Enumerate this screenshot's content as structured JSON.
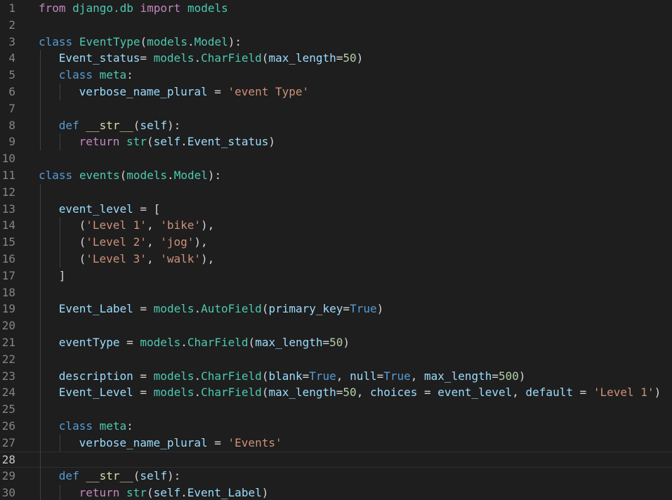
{
  "editor": {
    "lines": [
      {
        "n": "1",
        "indent": 0,
        "tokens": [
          [
            "kw2",
            "from"
          ],
          [
            "txt",
            " "
          ],
          [
            "cls",
            "django.db"
          ],
          [
            "txt",
            " "
          ],
          [
            "kw2",
            "import"
          ],
          [
            "txt",
            " "
          ],
          [
            "cls",
            "models"
          ]
        ]
      },
      {
        "n": "2",
        "indent": 0,
        "tokens": []
      },
      {
        "n": "3",
        "indent": 0,
        "tokens": [
          [
            "kw",
            "class"
          ],
          [
            "txt",
            " "
          ],
          [
            "cls",
            "EventType"
          ],
          [
            "txt",
            "("
          ],
          [
            "cls",
            "models"
          ],
          [
            "txt",
            "."
          ],
          [
            "cls",
            "Model"
          ],
          [
            "txt",
            "):"
          ]
        ]
      },
      {
        "n": "4",
        "indent": 1,
        "tokens": [
          [
            "var",
            "Event_status"
          ],
          [
            "txt",
            "= "
          ],
          [
            "cls",
            "models"
          ],
          [
            "txt",
            "."
          ],
          [
            "cls",
            "CharField"
          ],
          [
            "txt",
            "("
          ],
          [
            "var",
            "max_length"
          ],
          [
            "txt",
            "="
          ],
          [
            "num",
            "50"
          ],
          [
            "txt",
            ")"
          ]
        ]
      },
      {
        "n": "5",
        "indent": 1,
        "tokens": [
          [
            "kw",
            "class"
          ],
          [
            "txt",
            " "
          ],
          [
            "cls",
            "meta"
          ],
          [
            "txt",
            ":"
          ]
        ]
      },
      {
        "n": "6",
        "indent": 2,
        "tokens": [
          [
            "var",
            "verbose_name_plural"
          ],
          [
            "txt",
            " = "
          ],
          [
            "str",
            "'event Type'"
          ]
        ]
      },
      {
        "n": "7",
        "indent": 1,
        "tokens": []
      },
      {
        "n": "8",
        "indent": 1,
        "tokens": [
          [
            "kw",
            "def"
          ],
          [
            "txt",
            " "
          ],
          [
            "fn",
            "__str__"
          ],
          [
            "txt",
            "("
          ],
          [
            "var",
            "self"
          ],
          [
            "txt",
            "):"
          ]
        ]
      },
      {
        "n": "9",
        "indent": 2,
        "tokens": [
          [
            "kw2",
            "return"
          ],
          [
            "txt",
            " "
          ],
          [
            "cls",
            "str"
          ],
          [
            "txt",
            "("
          ],
          [
            "var",
            "self"
          ],
          [
            "txt",
            "."
          ],
          [
            "var",
            "Event_status"
          ],
          [
            "txt",
            ")"
          ]
        ]
      },
      {
        "n": "10",
        "indent": 0,
        "tokens": []
      },
      {
        "n": "11",
        "indent": 0,
        "tokens": [
          [
            "kw",
            "class"
          ],
          [
            "txt",
            " "
          ],
          [
            "cls",
            "events"
          ],
          [
            "txt",
            "("
          ],
          [
            "cls",
            "models"
          ],
          [
            "txt",
            "."
          ],
          [
            "cls",
            "Model"
          ],
          [
            "txt",
            "):"
          ]
        ]
      },
      {
        "n": "12",
        "indent": 1,
        "tokens": []
      },
      {
        "n": "13",
        "indent": 1,
        "tokens": [
          [
            "var",
            "event_level"
          ],
          [
            "txt",
            " = ["
          ]
        ]
      },
      {
        "n": "14",
        "indent": 2,
        "tokens": [
          [
            "txt",
            "("
          ],
          [
            "str",
            "'Level 1'"
          ],
          [
            "txt",
            ", "
          ],
          [
            "str",
            "'bike'"
          ],
          [
            "txt",
            "),"
          ]
        ]
      },
      {
        "n": "15",
        "indent": 2,
        "tokens": [
          [
            "txt",
            "("
          ],
          [
            "str",
            "'Level 2'"
          ],
          [
            "txt",
            ", "
          ],
          [
            "str",
            "'jog'"
          ],
          [
            "txt",
            "),"
          ]
        ]
      },
      {
        "n": "16",
        "indent": 2,
        "tokens": [
          [
            "txt",
            "("
          ],
          [
            "str",
            "'Level 3'"
          ],
          [
            "txt",
            ", "
          ],
          [
            "str",
            "'walk'"
          ],
          [
            "txt",
            "),"
          ]
        ]
      },
      {
        "n": "17",
        "indent": 1,
        "tokens": [
          [
            "txt",
            "]"
          ]
        ]
      },
      {
        "n": "18",
        "indent": 1,
        "tokens": []
      },
      {
        "n": "19",
        "indent": 1,
        "tokens": [
          [
            "var",
            "Event_Label"
          ],
          [
            "txt",
            " = "
          ],
          [
            "cls",
            "models"
          ],
          [
            "txt",
            "."
          ],
          [
            "cls",
            "AutoField"
          ],
          [
            "txt",
            "("
          ],
          [
            "var",
            "primary_key"
          ],
          [
            "txt",
            "="
          ],
          [
            "kw",
            "True"
          ],
          [
            "txt",
            ")"
          ]
        ]
      },
      {
        "n": "20",
        "indent": 1,
        "tokens": []
      },
      {
        "n": "21",
        "indent": 1,
        "tokens": [
          [
            "var",
            "eventType"
          ],
          [
            "txt",
            " = "
          ],
          [
            "cls",
            "models"
          ],
          [
            "txt",
            "."
          ],
          [
            "cls",
            "CharField"
          ],
          [
            "txt",
            "("
          ],
          [
            "var",
            "max_length"
          ],
          [
            "txt",
            "="
          ],
          [
            "num",
            "50"
          ],
          [
            "txt",
            ")"
          ]
        ]
      },
      {
        "n": "22",
        "indent": 1,
        "tokens": []
      },
      {
        "n": "23",
        "indent": 1,
        "tokens": [
          [
            "var",
            "description"
          ],
          [
            "txt",
            " = "
          ],
          [
            "cls",
            "models"
          ],
          [
            "txt",
            "."
          ],
          [
            "cls",
            "CharField"
          ],
          [
            "txt",
            "("
          ],
          [
            "var",
            "blank"
          ],
          [
            "txt",
            "="
          ],
          [
            "kw",
            "True"
          ],
          [
            "txt",
            ", "
          ],
          [
            "var",
            "null"
          ],
          [
            "txt",
            "="
          ],
          [
            "kw",
            "True"
          ],
          [
            "txt",
            ", "
          ],
          [
            "var",
            "max_length"
          ],
          [
            "txt",
            "="
          ],
          [
            "num",
            "500"
          ],
          [
            "txt",
            ")"
          ]
        ]
      },
      {
        "n": "24",
        "indent": 1,
        "tokens": [
          [
            "var",
            "Event_Level"
          ],
          [
            "txt",
            " = "
          ],
          [
            "cls",
            "models"
          ],
          [
            "txt",
            "."
          ],
          [
            "cls",
            "CharField"
          ],
          [
            "txt",
            "("
          ],
          [
            "var",
            "max_length"
          ],
          [
            "txt",
            "="
          ],
          [
            "num",
            "50"
          ],
          [
            "txt",
            ", "
          ],
          [
            "var",
            "choices"
          ],
          [
            "txt",
            " = "
          ],
          [
            "var",
            "event_level"
          ],
          [
            "txt",
            ", "
          ],
          [
            "var",
            "default"
          ],
          [
            "txt",
            " = "
          ],
          [
            "str",
            "'Level 1'"
          ],
          [
            "txt",
            ")"
          ]
        ]
      },
      {
        "n": "25",
        "indent": 1,
        "tokens": []
      },
      {
        "n": "26",
        "indent": 1,
        "tokens": [
          [
            "kw",
            "class"
          ],
          [
            "txt",
            " "
          ],
          [
            "cls",
            "meta"
          ],
          [
            "txt",
            ":"
          ]
        ]
      },
      {
        "n": "27",
        "indent": 2,
        "tokens": [
          [
            "var",
            "verbose_name_plural"
          ],
          [
            "txt",
            " = "
          ],
          [
            "str",
            "'Events'"
          ]
        ]
      },
      {
        "n": "28",
        "indent": 1,
        "current": true,
        "tokens": []
      },
      {
        "n": "29",
        "indent": 1,
        "tokens": [
          [
            "kw",
            "def"
          ],
          [
            "txt",
            " "
          ],
          [
            "fn",
            "__str__"
          ],
          [
            "txt",
            "("
          ],
          [
            "var",
            "self"
          ],
          [
            "txt",
            "):"
          ]
        ]
      },
      {
        "n": "30",
        "indent": 2,
        "tokens": [
          [
            "kw2",
            "return"
          ],
          [
            "txt",
            " "
          ],
          [
            "cls",
            "str"
          ],
          [
            "txt",
            "("
          ],
          [
            "var",
            "self"
          ],
          [
            "txt",
            "."
          ],
          [
            "var",
            "Event_Label"
          ],
          [
            "txt",
            ")"
          ]
        ]
      }
    ]
  },
  "colors": {
    "background": "#1e1e1e",
    "line_number": "#858585",
    "keyword": "#569cd6",
    "control_keyword": "#c586c0",
    "class_name": "#4ec9b0",
    "function": "#dcdcaa",
    "string": "#ce9178",
    "number": "#b5cea8",
    "variable": "#9cdcfe",
    "text": "#d4d4d4"
  }
}
